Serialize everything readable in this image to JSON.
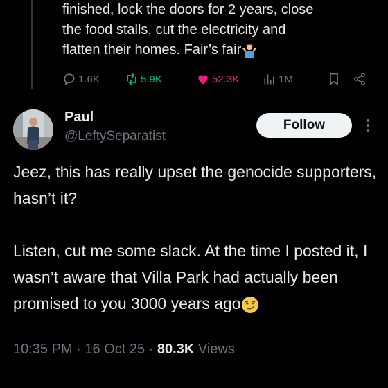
{
  "previous_tweet": {
    "line1": "finished, lock the doors for 2 years, close",
    "line2": "the food stalls, cut the electricity and",
    "line3": "flatten their homes. Fair’s fair",
    "emoji": "person-shrugging-emoji",
    "stats": {
      "replies": "1.6K",
      "reposts": "5.9K",
      "likes": "52.3K",
      "views": "1M"
    }
  },
  "tweet": {
    "name": "Paul",
    "handle": "@LeftySeparatist",
    "follow_label": "Follow",
    "body_part1": "Jeez, this has really upset the genocide supporters, hasn’t it?\n\nListen, cut me some slack. At the time I posted it, I wasn’t aware that Villa Park had actually been promised to you 3000 years ago",
    "body_emoji": "smirking-face-emoji",
    "time": "10:35 PM",
    "date": "16 Oct 25",
    "views_count": "80.3K",
    "views_label": "Views"
  },
  "colors": {
    "background": "#000000",
    "text": "#e7e9ea",
    "muted": "#71767b",
    "repost": "#00ba7c",
    "like": "#f91880"
  }
}
